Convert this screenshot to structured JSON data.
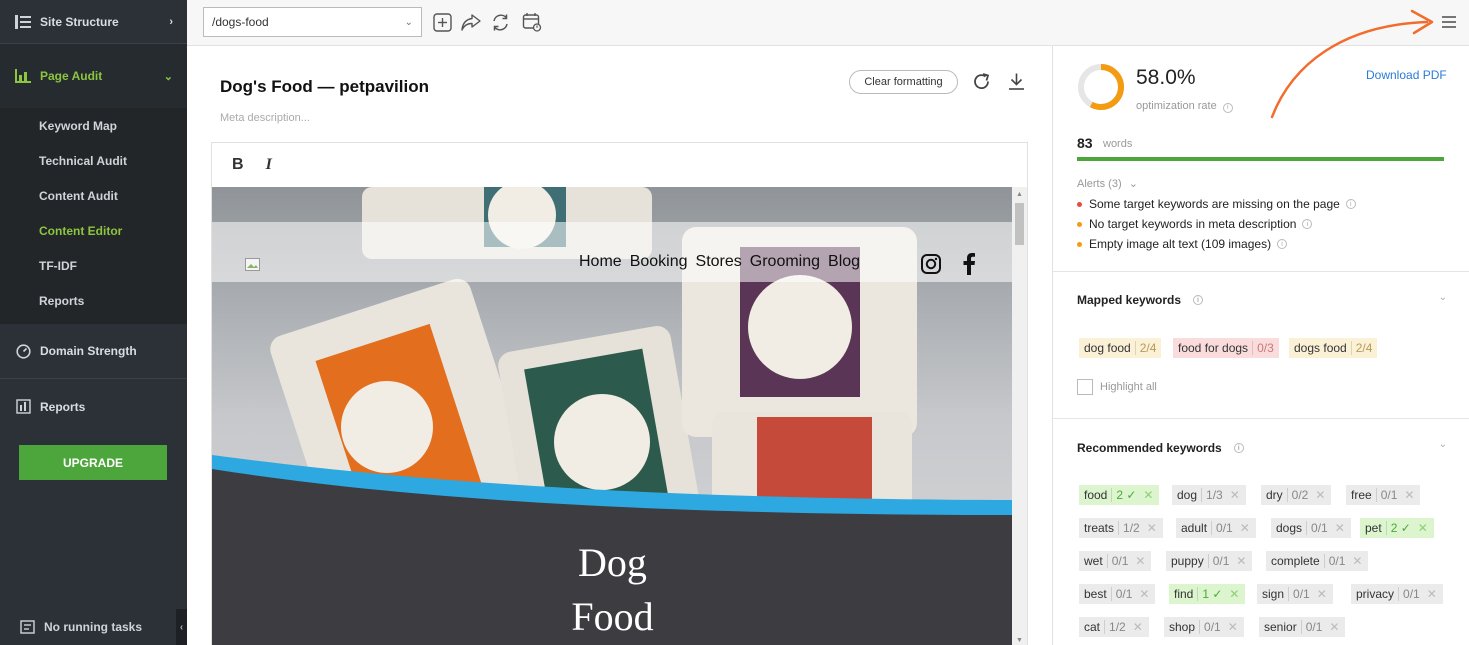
{
  "sidebar": {
    "site_structure": "Site Structure",
    "page_audit": "Page Audit",
    "sub_items": [
      "Keyword Map",
      "Technical Audit",
      "Content Audit",
      "Content Editor",
      "TF-IDF",
      "Reports"
    ],
    "domain_strength": "Domain Strength",
    "reports": "Reports",
    "upgrade": "UPGRADE",
    "running_tasks": "No running tasks"
  },
  "toolbar": {
    "url_value": "/dogs-food"
  },
  "editor": {
    "title": "Dog's Food — petpavilion",
    "meta_placeholder": "Meta description...",
    "clear_formatting": "Clear formatting",
    "bold": "B",
    "italic": "I",
    "site_nav": [
      "Home",
      "Booking",
      "Stores",
      "Grooming",
      "Blog"
    ],
    "hero_line1": "Dog",
    "hero_line2": "Food"
  },
  "panel": {
    "rate": "58.0%",
    "rate_fraction": 0.58,
    "rate_label": "optimization rate",
    "download": "Download PDF",
    "words_count": "83",
    "words_label": "words",
    "alerts_title": "Alerts (3)",
    "alerts": [
      {
        "text": "Some target keywords are missing on the page",
        "color": "#e74c3c"
      },
      {
        "text": "No target keywords in meta description",
        "color": "#f39c12"
      },
      {
        "text": "Empty image alt text (109 images)",
        "color": "#f39c12"
      }
    ],
    "mapped_title": "Mapped keywords",
    "mapped": [
      {
        "name": "dog food",
        "count": "2/4",
        "style": "yellow"
      },
      {
        "name": "food for dogs",
        "count": "0/3",
        "style": "red"
      },
      {
        "name": "dogs food",
        "count": "2/4",
        "style": "yellow"
      }
    ],
    "highlight_all": "Highlight all",
    "recommended_title": "Recommended keywords",
    "recommended": [
      [
        {
          "name": "food",
          "count": "2 ✓",
          "style": "green"
        },
        {
          "name": "dog",
          "count": "1/3",
          "style": "grey"
        },
        {
          "name": "dry",
          "count": "0/2",
          "style": "grey"
        },
        {
          "name": "free",
          "count": "0/1",
          "style": "grey"
        }
      ],
      [
        {
          "name": "treats",
          "count": "1/2",
          "style": "grey"
        },
        {
          "name": "adult",
          "count": "0/1",
          "style": "grey"
        },
        {
          "name": "dogs",
          "count": "0/1",
          "style": "grey"
        },
        {
          "name": "pet",
          "count": "2 ✓",
          "style": "green"
        }
      ],
      [
        {
          "name": "wet",
          "count": "0/1",
          "style": "grey"
        },
        {
          "name": "puppy",
          "count": "0/1",
          "style": "grey"
        },
        {
          "name": "complete",
          "count": "0/1",
          "style": "grey"
        }
      ],
      [
        {
          "name": "best",
          "count": "0/1",
          "style": "grey"
        },
        {
          "name": "find",
          "count": "1 ✓",
          "style": "green"
        },
        {
          "name": "sign",
          "count": "0/1",
          "style": "grey"
        },
        {
          "name": "privacy",
          "count": "0/1",
          "style": "grey"
        }
      ],
      [
        {
          "name": "cat",
          "count": "1/2",
          "style": "grey"
        },
        {
          "name": "shop",
          "count": "0/1",
          "style": "grey"
        },
        {
          "name": "senior",
          "count": "0/1",
          "style": "grey"
        }
      ]
    ]
  },
  "colors": {
    "accent_green": "#8cc63f",
    "upgrade_green": "#4da63c",
    "rate_orange": "#f39c12",
    "link_blue": "#2b7bd6",
    "arrow_orange": "#f26d2d"
  }
}
